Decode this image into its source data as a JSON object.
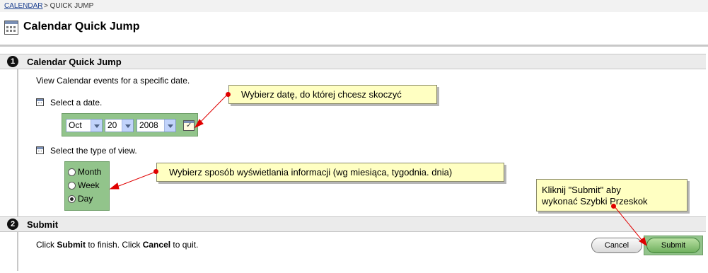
{
  "breadcrumb": {
    "link": "CALENDAR",
    "separator": "> QUICK JUMP"
  },
  "page_title": "Calendar Quick Jump",
  "section1": {
    "step": "1",
    "title": "Calendar Quick Jump",
    "description": "View Calendar events for a specific date.",
    "date_label": "Select a date.",
    "month_value": "Oct",
    "day_value": "20",
    "year_value": "2008",
    "view_label": "Select the type of view.",
    "view_options": [
      "Month",
      "Week",
      "Day"
    ],
    "view_selected": "Day"
  },
  "section2": {
    "step": "2",
    "title": "Submit",
    "instruction": {
      "p1": "Click ",
      "submit_word": "Submit",
      "p2": " to finish. Click ",
      "cancel_word": "Cancel",
      "p3": " to quit."
    },
    "cancel_label": "Cancel",
    "submit_label": "Submit"
  },
  "callouts": {
    "date": "Wybierz datę, do której chcesz skoczyć",
    "view": "Wybierz sposób wyświetlania informacji (wg miesiąca, tygodnia. dnia)",
    "submit_line1": "Kliknij \"Submit\" aby",
    "submit_line2": "wykonać Szybki Przeskok"
  },
  "colors": {
    "highlight_box": "#92c48b",
    "callout_bg": "#ffffc2",
    "arrow": "#e00000",
    "section_bar": "#ebebeb"
  }
}
